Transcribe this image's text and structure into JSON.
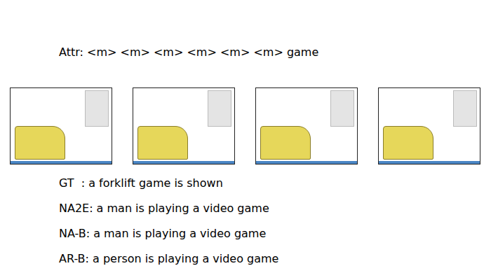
{
  "attribute": "Attr: <m> <m> <m> <m> <m> <m> game",
  "captions": [
    {
      "label": "GT  :",
      "text": "a forklift game is shown"
    },
    {
      "label": "NA2E:",
      "text": "a man is playing a video game"
    },
    {
      "label": "NA-B:",
      "text": "a man is playing a video game"
    },
    {
      "label": "AR-B:",
      "text": "a person is playing a video game"
    }
  ]
}
